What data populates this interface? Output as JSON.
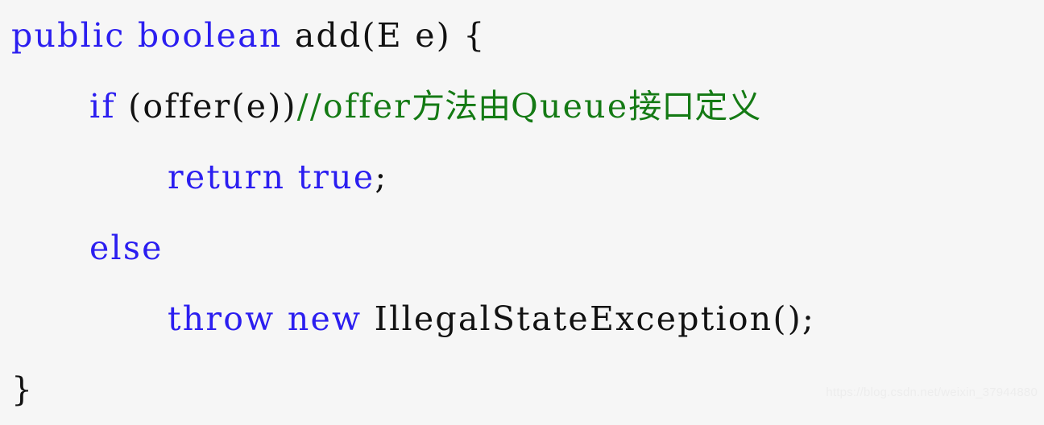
{
  "figure": {
    "kind": "code-snippet-image",
    "language": "java",
    "background_color": "#f6f6f6",
    "colors": {
      "keyword": "#2b1ef0",
      "plain": "#121212",
      "comment": "#147a14",
      "watermark": "#ededed"
    }
  },
  "code": {
    "full_text": "public boolean add(E e) {\n    if (offer(e))//offer方法由Queue接口定义\n        return true;\n    else\n        throw new IllegalStateException();\n}",
    "lines": [
      {
        "indent": 0,
        "tokens": [
          {
            "text": "public boolean",
            "kind": "keyword"
          },
          {
            "text": " add(E e) {",
            "kind": "plain"
          }
        ]
      },
      {
        "indent": 1,
        "tokens": [
          {
            "text": "if",
            "kind": "keyword"
          },
          {
            "text": " (offer(e))",
            "kind": "plain"
          },
          {
            "text": "//offer",
            "kind": "comment"
          },
          {
            "text": "方法由",
            "kind": "comment-cjk"
          },
          {
            "text": "Queue",
            "kind": "comment"
          },
          {
            "text": "接口定义",
            "kind": "comment-cjk"
          }
        ]
      },
      {
        "indent": 2,
        "tokens": [
          {
            "text": "return true",
            "kind": "keyword"
          },
          {
            "text": ";",
            "kind": "plain"
          }
        ]
      },
      {
        "indent": 1,
        "tokens": [
          {
            "text": "else",
            "kind": "keyword"
          }
        ]
      },
      {
        "indent": 2,
        "tokens": [
          {
            "text": "throw new",
            "kind": "keyword"
          },
          {
            "text": " IllegalStateException();",
            "kind": "plain"
          }
        ]
      },
      {
        "indent": 0,
        "tokens": [
          {
            "text": "}",
            "kind": "plain"
          }
        ]
      }
    ]
  },
  "watermark": {
    "text": "https://blog.csdn.net/weixin_37944880"
  }
}
